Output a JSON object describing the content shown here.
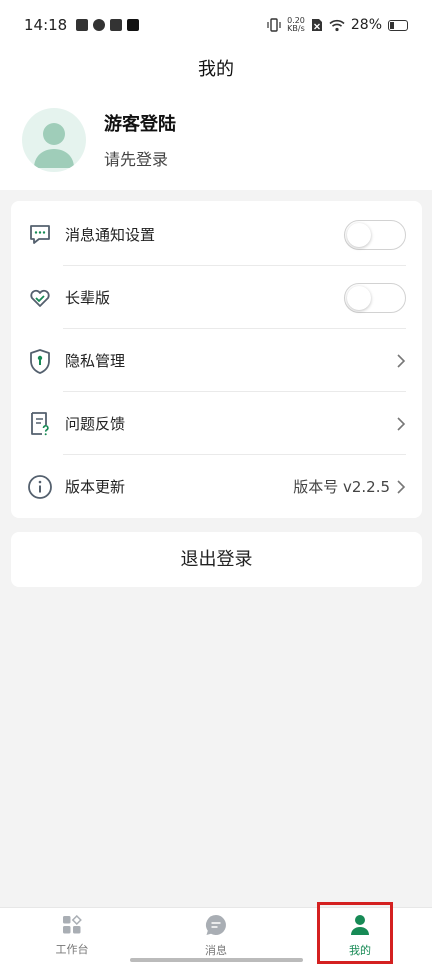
{
  "status_bar": {
    "time": "14:18",
    "net_speed_value": "0.20",
    "net_speed_unit": "KB/s",
    "battery": "28%"
  },
  "header": {
    "title": "我的"
  },
  "profile": {
    "name": "游客登陆",
    "subtitle": "请先登录"
  },
  "settings": {
    "items": [
      {
        "label": "消息通知设置",
        "icon": "message-settings-icon",
        "control": "toggle",
        "on": false
      },
      {
        "label": "长辈版",
        "icon": "heart-icon",
        "control": "toggle",
        "on": false
      },
      {
        "label": "隐私管理",
        "icon": "shield-icon",
        "control": "chevron"
      },
      {
        "label": "问题反馈",
        "icon": "feedback-icon",
        "control": "chevron"
      },
      {
        "label": "版本更新",
        "icon": "info-icon",
        "control": "chevron",
        "value": "版本号 v2.2.5"
      }
    ]
  },
  "logout": {
    "label": "退出登录"
  },
  "tabbar": {
    "tabs": [
      {
        "label": "工作台",
        "icon": "workbench-icon",
        "active": false
      },
      {
        "label": "消息",
        "icon": "chat-icon",
        "active": false
      },
      {
        "label": "我的",
        "icon": "person-icon",
        "active": true
      }
    ]
  },
  "colors": {
    "accent": "#178a55",
    "icon_stroke": "#54606e",
    "highlight": "#d42020"
  }
}
